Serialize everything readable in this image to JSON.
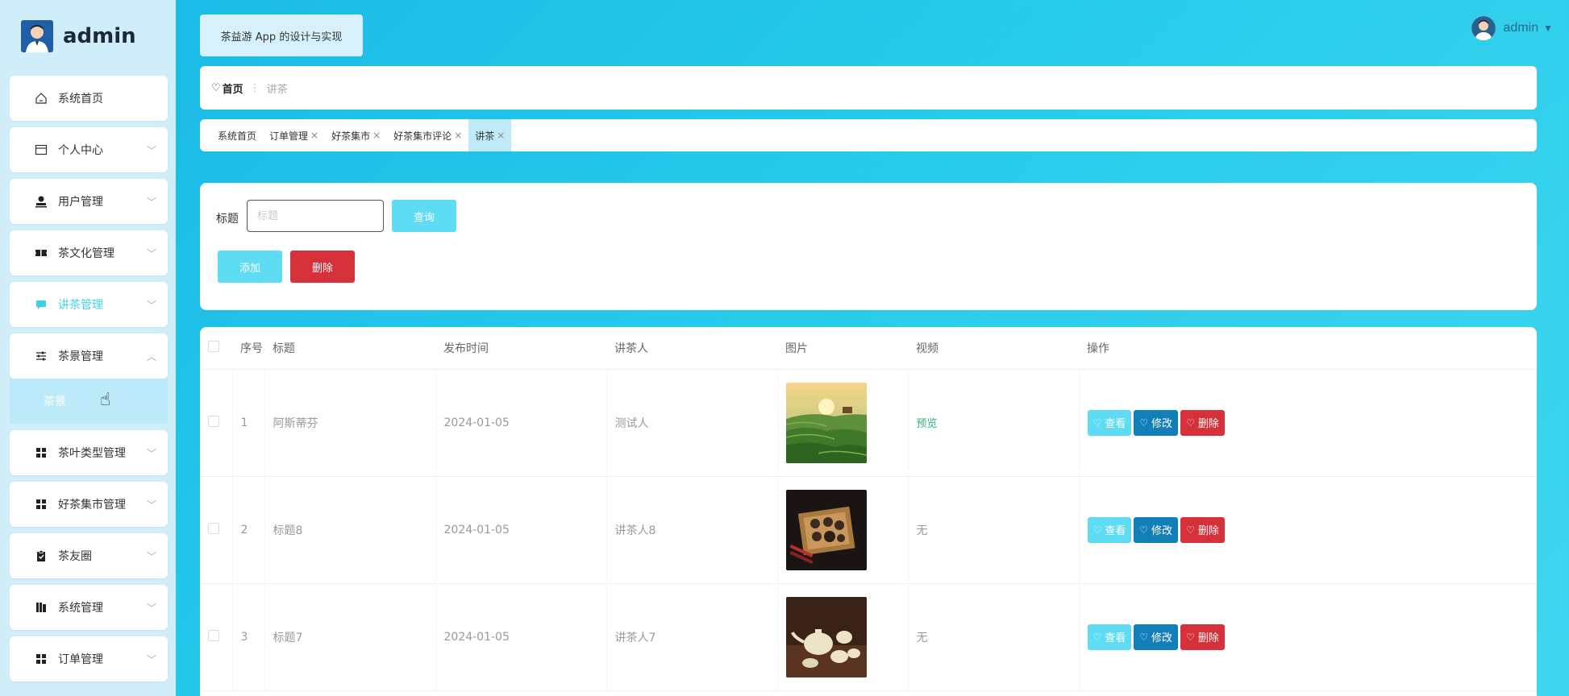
{
  "brand": {
    "name": "admin",
    "avatar_icon": "user-avatar-icon"
  },
  "sidebar": {
    "items": [
      {
        "label": "系统首页",
        "icon": "home-icon",
        "has_arrow": false
      },
      {
        "label": "个人中心",
        "icon": "id-card-icon",
        "has_arrow": true
      },
      {
        "label": "用户管理",
        "icon": "user-icon",
        "has_arrow": true
      },
      {
        "label": "茶文化管理",
        "icon": "ticket-icon",
        "has_arrow": true
      },
      {
        "label": "讲茶管理",
        "icon": "message-icon",
        "has_arrow": true,
        "active": true
      },
      {
        "label": "茶景管理",
        "icon": "sliders-icon",
        "has_arrow": true,
        "expanded": true
      },
      {
        "label": "茶叶类型管理",
        "icon": "grid-icon",
        "has_arrow": true
      },
      {
        "label": "好茶集市管理",
        "icon": "grid-icon",
        "has_arrow": true
      },
      {
        "label": "茶友圈",
        "icon": "clipboard-icon",
        "has_arrow": true
      },
      {
        "label": "系统管理",
        "icon": "bars-icon",
        "has_arrow": true
      },
      {
        "label": "订单管理",
        "icon": "grid-icon",
        "has_arrow": true
      }
    ],
    "submenu": {
      "label": "茶景"
    }
  },
  "header": {
    "app_title": "茶益游 App 的设计与实现",
    "user_name": "admin"
  },
  "breadcrumb": {
    "home": "首页",
    "current": "讲茶"
  },
  "tags": [
    {
      "label": "系统首页",
      "closable": false
    },
    {
      "label": "订单管理",
      "closable": true
    },
    {
      "label": "好茶集市",
      "closable": true
    },
    {
      "label": "好茶集市评论",
      "closable": true
    },
    {
      "label": "讲茶",
      "closable": true,
      "active": true
    }
  ],
  "search": {
    "label": "标题",
    "placeholder": "标题",
    "query_button": "查询",
    "add_button": "添加",
    "delete_button": "删除"
  },
  "table": {
    "columns": [
      "序号",
      "标题",
      "发布时间",
      "讲茶人",
      "图片",
      "视频",
      "操作"
    ],
    "rows": [
      {
        "index": "1",
        "title": "阿斯蒂芬",
        "date": "2024-01-05",
        "speaker": "测试人",
        "image": "tea-plantation",
        "video": "预览"
      },
      {
        "index": "2",
        "title": "标题8",
        "date": "2024-01-05",
        "speaker": "讲茶人8",
        "image": "tea-set-tray",
        "video": "无"
      },
      {
        "index": "3",
        "title": "标题7",
        "date": "2024-01-05",
        "speaker": "讲茶人7",
        "image": "white-teapot",
        "video": "无"
      }
    ],
    "actions": {
      "view": "查看",
      "edit": "修改",
      "delete": "删除"
    }
  },
  "colors": {
    "accent": "#5ddcf3",
    "edit": "#137fb8",
    "danger": "#d6313a",
    "sidebar_bg": "#cfeefa",
    "preview_link": "#2db37a"
  }
}
